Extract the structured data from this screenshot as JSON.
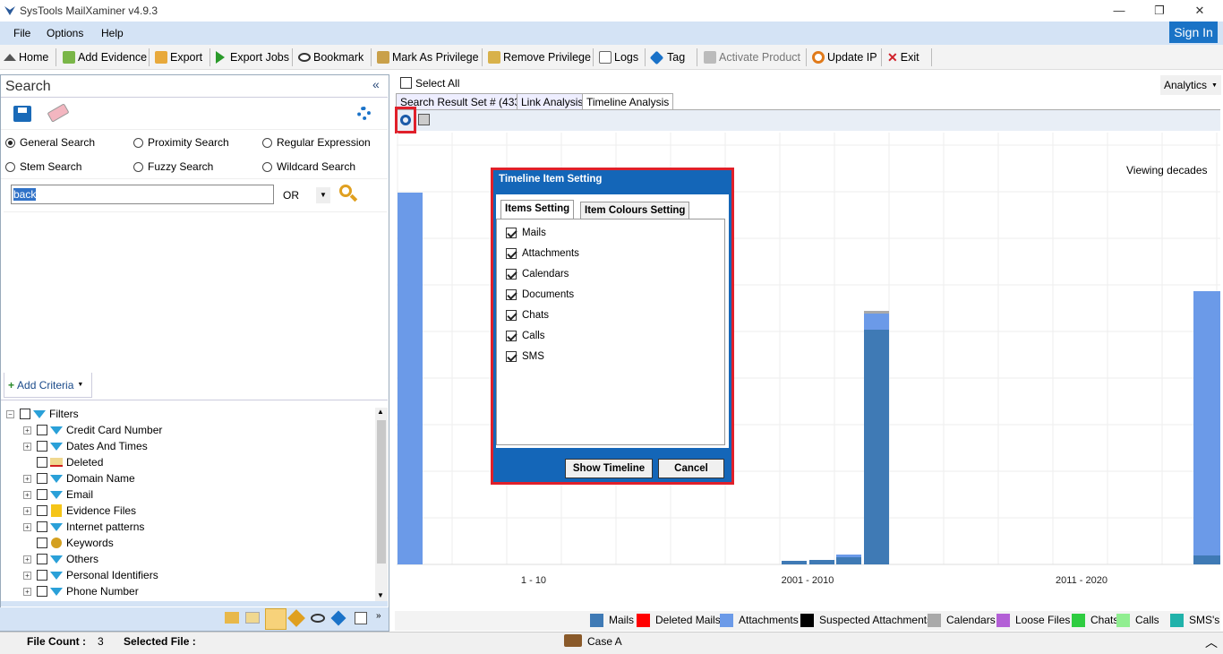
{
  "app": {
    "title": "SysTools MailXaminer v4.9.3"
  },
  "menu": {
    "items": [
      "File",
      "Options",
      "Help"
    ],
    "sign_in": "Sign In"
  },
  "toolbar": {
    "home": "Home",
    "add_evidence": "Add Evidence",
    "export": "Export",
    "export_jobs": "Export Jobs",
    "bookmark": "Bookmark",
    "mark_privilege": "Mark As Privilege",
    "remove_privilege": "Remove Privilege",
    "logs": "Logs",
    "tag": "Tag",
    "activate": "Activate Product",
    "update_ip": "Update IP",
    "exit": "Exit"
  },
  "search": {
    "title": "Search",
    "collapse": "«",
    "options": [
      "General Search",
      "Proximity Search",
      "Regular Expression",
      "Stem Search",
      "Fuzzy Search",
      "Wildcard Search"
    ],
    "selected": "General Search",
    "query": "back",
    "operator": "OR",
    "add_criteria": "Add Criteria"
  },
  "filters": {
    "root": "Filters",
    "items": [
      "Credit Card Number",
      "Dates And Times",
      "Deleted",
      "Domain Name",
      "Email",
      "Evidence Files",
      "Internet patterns",
      "Keywords",
      "Others",
      "Personal Identifiers",
      "Phone Number"
    ]
  },
  "main": {
    "select_all": "Select All",
    "analytics": "Analytics",
    "tabs": [
      "Search Result Set # (433)",
      "Link Analysis",
      "Timeline Analysis"
    ],
    "active_tab": "Timeline Analysis",
    "viewing": "Viewing decades"
  },
  "dialog": {
    "title": "Timeline Item Setting",
    "tabs": [
      "Items Setting",
      "Item Colours Setting"
    ],
    "items": [
      "Mails",
      "Attachments",
      "Calendars",
      "Documents",
      "Chats",
      "Calls",
      "SMS"
    ],
    "show_button": "Show Timeline",
    "cancel_button": "Cancel"
  },
  "chart_data": {
    "type": "bar",
    "categories": [
      "1 - 10",
      "2001 - 2010",
      "2011 - 2020"
    ]
  },
  "legend": [
    {
      "name": "Mails",
      "color": "#3f7ab5"
    },
    {
      "name": "Deleted Mails",
      "color": "#ff0000"
    },
    {
      "name": "Attachments",
      "color": "#6b9ae8"
    },
    {
      "name": "Suspected Attachments",
      "color": "#000000"
    },
    {
      "name": "Calendars",
      "color": "#a9a9a9"
    },
    {
      "name": "Loose Files",
      "color": "#b35fd6"
    },
    {
      "name": "Chats",
      "color": "#2ecc40"
    },
    {
      "name": "Calls",
      "color": "#90ee90"
    },
    {
      "name": "SMS's",
      "color": "#20b2aa"
    }
  ],
  "status": {
    "file_count_label": "File Count :",
    "file_count": "3",
    "selected_file_label": "Selected File :",
    "case": "Case A"
  }
}
